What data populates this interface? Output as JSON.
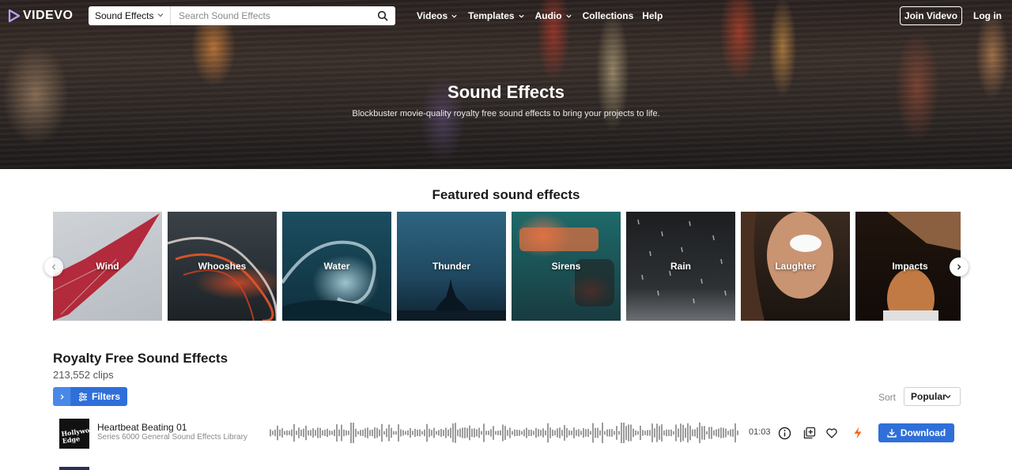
{
  "brand": {
    "name": "VIDEVO"
  },
  "search": {
    "category": "Sound Effects",
    "placeholder": "Search Sound Effects"
  },
  "nav": {
    "items": [
      {
        "label": "Videos"
      },
      {
        "label": "Templates"
      },
      {
        "label": "Audio"
      },
      {
        "label": "Collections"
      },
      {
        "label": "Help"
      }
    ],
    "join_label": "Join Videvo",
    "login_label": "Log in"
  },
  "hero": {
    "title": "Sound Effects",
    "subtitle": "Blockbuster movie-quality royalty free sound effects to bring your projects to life."
  },
  "featured": {
    "title": "Featured sound effects",
    "tiles": [
      {
        "label": "Wind"
      },
      {
        "label": "Whooshes"
      },
      {
        "label": "Water"
      },
      {
        "label": "Thunder"
      },
      {
        "label": "Sirens"
      },
      {
        "label": "Rain"
      },
      {
        "label": "Laughter"
      },
      {
        "label": "Impacts"
      }
    ]
  },
  "listing": {
    "title": "Royalty Free Sound Effects",
    "count": "213,552 clips",
    "filters_label": "Filters",
    "sort_label": "Sort",
    "sort_value": "Popular",
    "tracks": [
      {
        "name": "Heartbeat Beating 01",
        "series": "Series 6000 General Sound Effects Library",
        "duration": "01:03",
        "thumb_text": "Hollywood Edge",
        "download_label": "Download"
      }
    ]
  },
  "colors": {
    "accent": "#2f6fd9",
    "lightning": "#f26a1b"
  }
}
